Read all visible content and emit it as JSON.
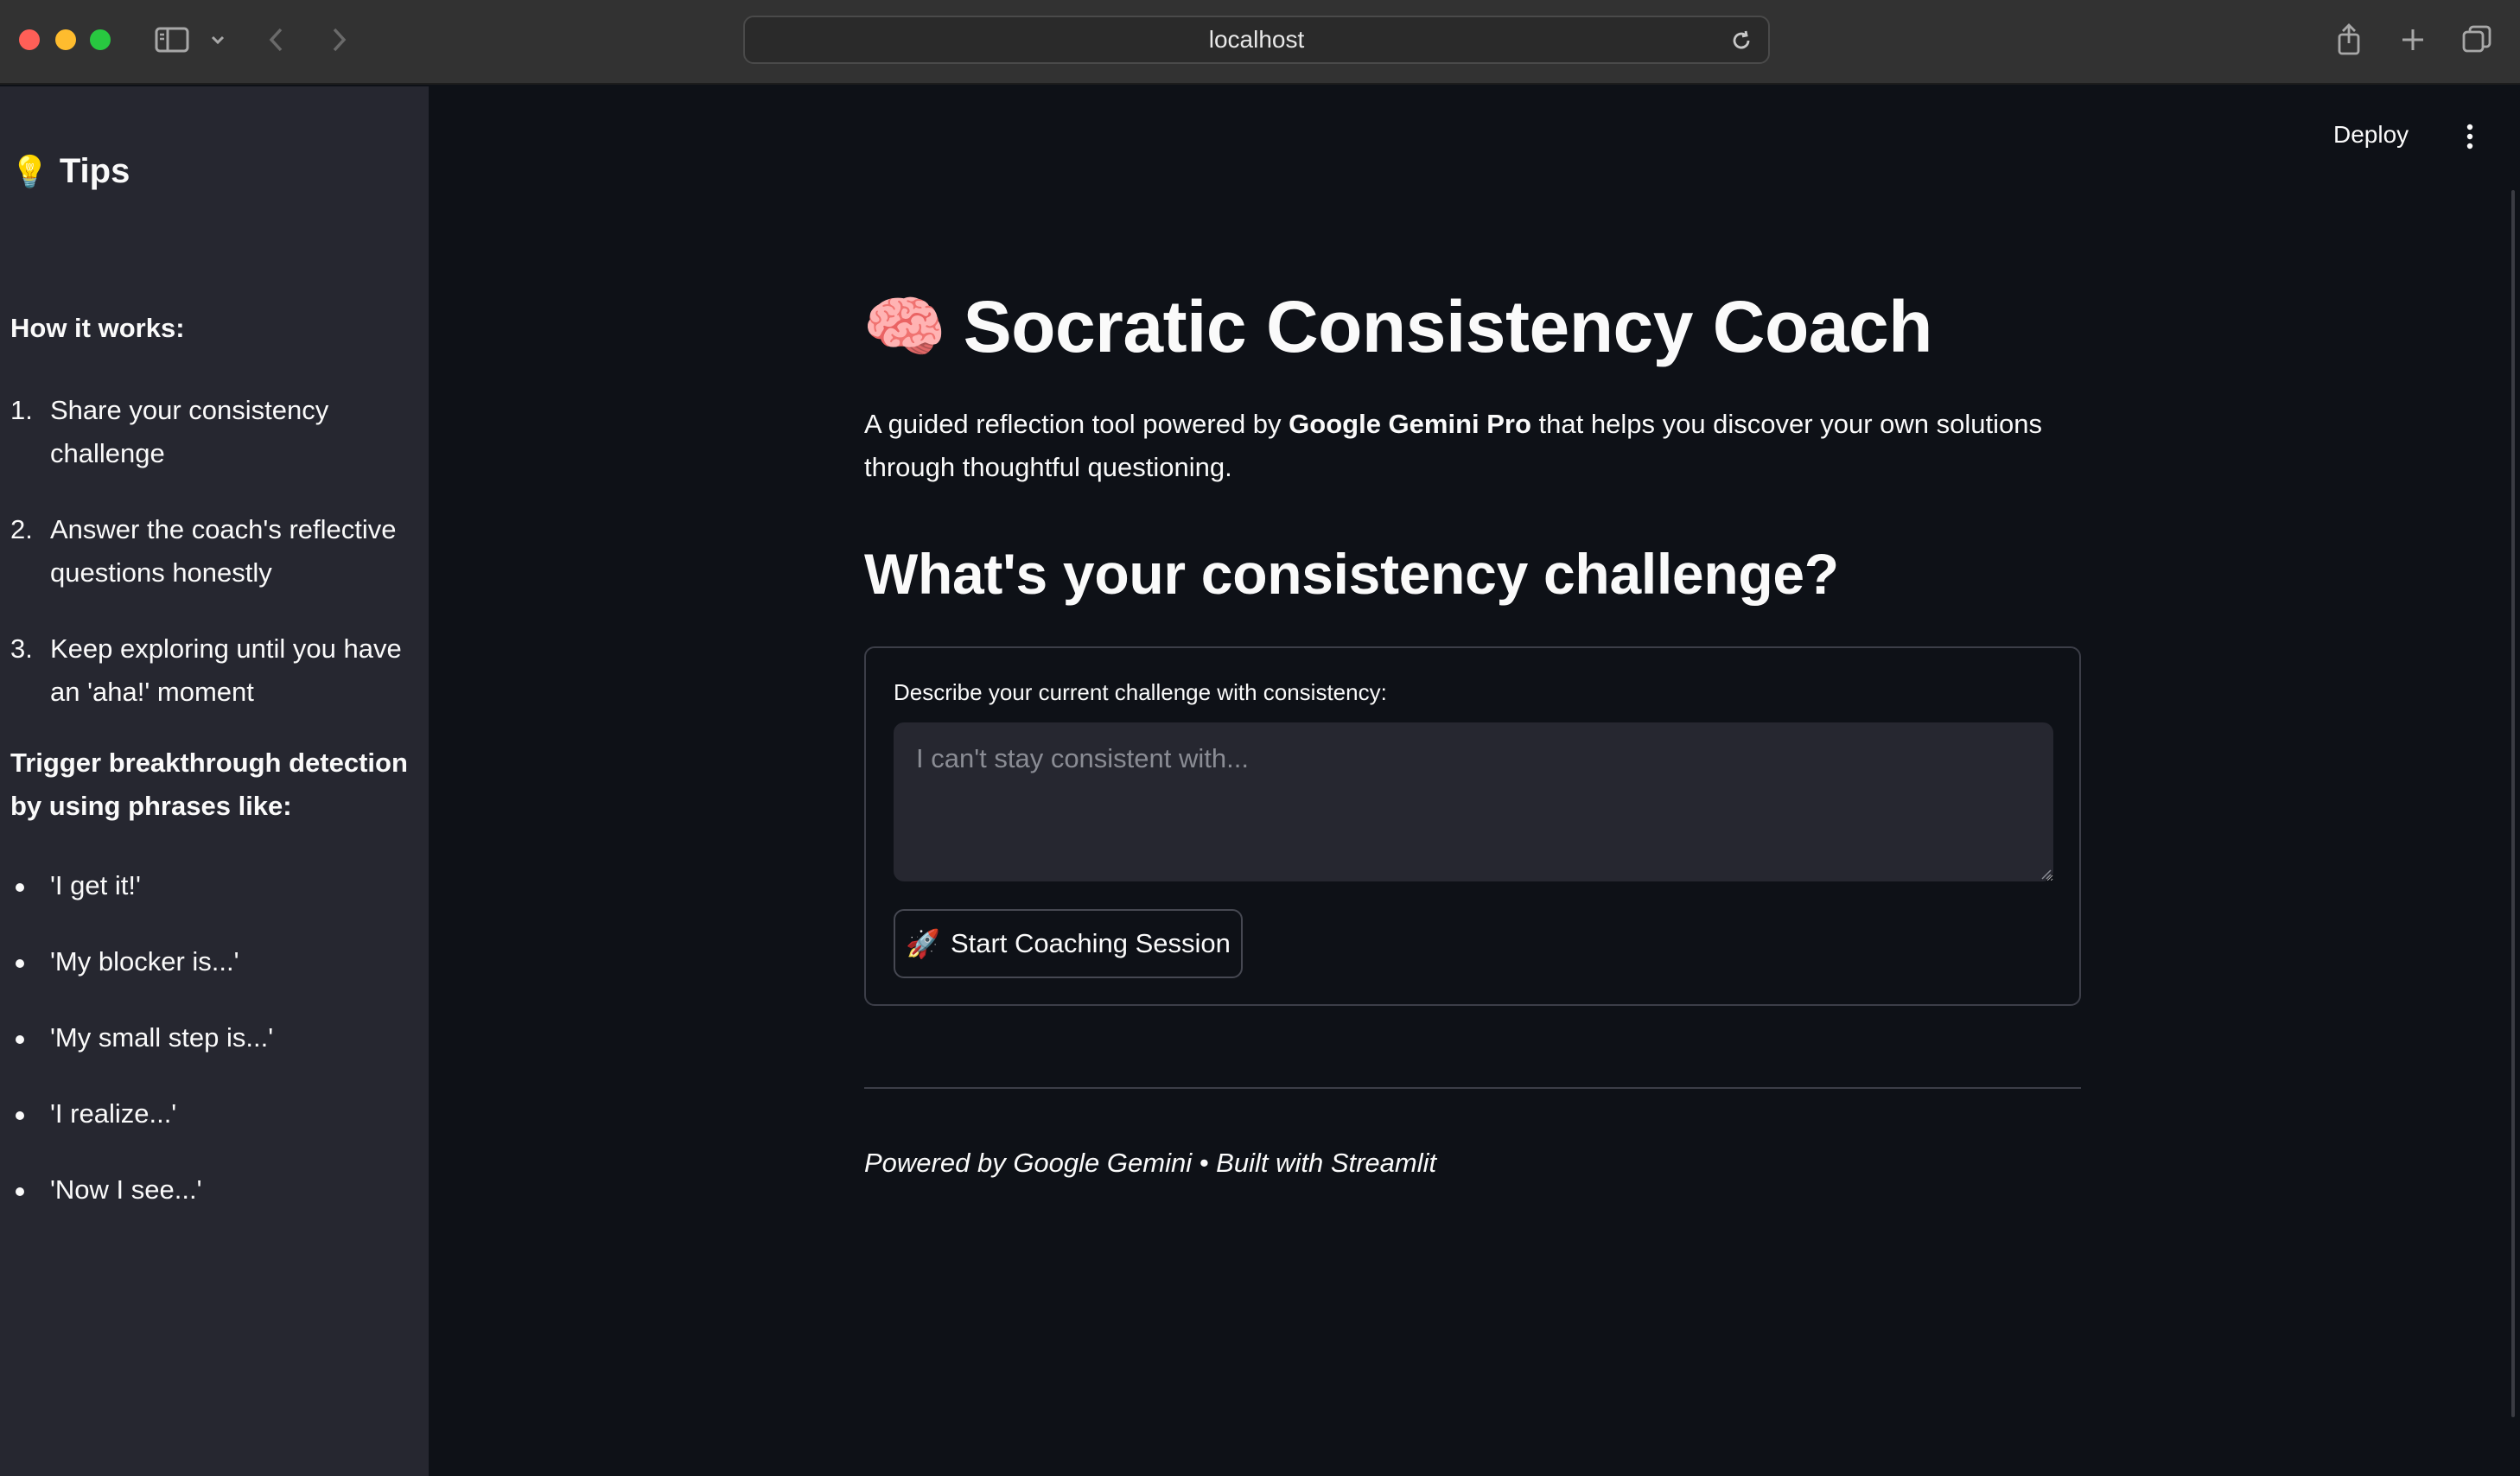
{
  "browser": {
    "url": "localhost",
    "icons": [
      "sidebar-toggle-icon",
      "chevron-down-icon",
      "back-arrow-icon",
      "forward-arrow-icon",
      "reload-icon",
      "share-icon",
      "plus-icon",
      "tabs-icon"
    ]
  },
  "header": {
    "deploy_label": "Deploy"
  },
  "sidebar": {
    "title_icon": "💡",
    "title": "Tips",
    "how_label": "How it works:",
    "steps": [
      {
        "num": "1.",
        "text": "Share your consistency challenge"
      },
      {
        "num": "2.",
        "text": "Answer the coach's reflective questions honestly"
      },
      {
        "num": "3.",
        "text": "Keep exploring until you have an 'aha!' moment"
      }
    ],
    "trigger_label": "Trigger breakthrough detection by using phrases like:",
    "phrases": [
      "'I get it!'",
      "'My blocker is...'",
      "'My small step is...'",
      "'I realize...'",
      "'Now I see...'"
    ]
  },
  "main": {
    "title_icon": "🧠",
    "title": "Socratic Consistency Coach",
    "intro_prefix": "A guided reflection tool powered by ",
    "intro_bold": "Google Gemini Pro",
    "intro_suffix": " that helps you discover your own solutions through thoughtful questioning.",
    "section_heading": "What's your consistency challenge?",
    "form": {
      "field_label": "Describe your current challenge with consistency:",
      "textarea_value": "",
      "textarea_placeholder": "I can't stay consistent with...",
      "button_icon": "🚀",
      "button_label": "Start Coaching Session"
    },
    "footer": "Powered by Google Gemini • Built with Streamlit"
  }
}
